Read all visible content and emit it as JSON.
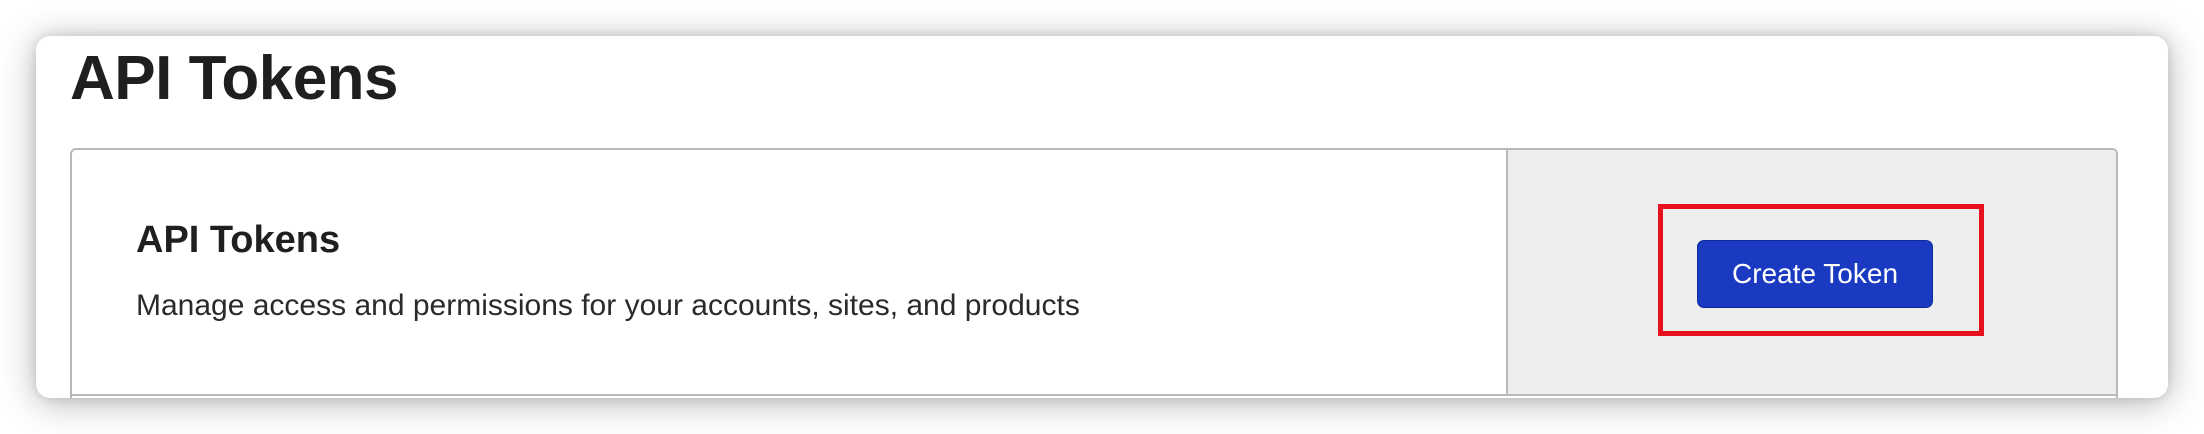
{
  "page": {
    "title": "API Tokens"
  },
  "card": {
    "heading": "API Tokens",
    "description": "Manage access and permissions for your accounts, sites, and products",
    "create_button_label": "Create Token"
  },
  "colors": {
    "button_background": "#1a3bc1",
    "highlight_border": "#e8101e",
    "aside_background": "#eeeeee"
  }
}
